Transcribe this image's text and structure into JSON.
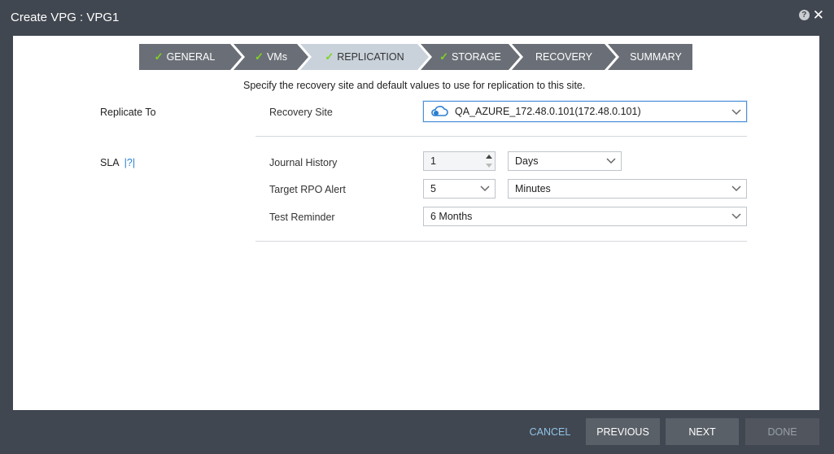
{
  "window": {
    "title": "Create VPG : VPG1",
    "help_glyph": "?",
    "close_glyph": "✕"
  },
  "steps": [
    {
      "label": "GENERAL",
      "done": true
    },
    {
      "label": "VMs",
      "done": true
    },
    {
      "label": "REPLICATION",
      "done": true,
      "active": true
    },
    {
      "label": "STORAGE",
      "done": true
    },
    {
      "label": "RECOVERY",
      "done": false
    },
    {
      "label": "SUMMARY",
      "done": false
    }
  ],
  "instructions": "Specify the recovery site and default values to use for replication to this site.",
  "replicate_to": {
    "section_label": "Replicate To",
    "recovery_site_label": "Recovery Site",
    "recovery_site_value": "QA_AZURE_172.48.0.101(172.48.0.101)"
  },
  "sla": {
    "section_label": "SLA",
    "help_text": "|?|",
    "journal_history_label": "Journal History",
    "journal_history_value": "1",
    "journal_history_unit": "Days",
    "target_rpo_label": "Target RPO Alert",
    "target_rpo_value": "5",
    "target_rpo_unit": "Minutes",
    "test_reminder_label": "Test Reminder",
    "test_reminder_value": "6 Months"
  },
  "footer": {
    "cancel": "CANCEL",
    "previous": "PREVIOUS",
    "next": "NEXT",
    "done": "DONE"
  },
  "colors": {
    "step_done_check": "#7ed321",
    "step_bg": "#6a6f77",
    "step_active_bg": "#c9d2db",
    "accent_link": "#2b7fd0",
    "cloud_icon": "#2b7fd0"
  }
}
